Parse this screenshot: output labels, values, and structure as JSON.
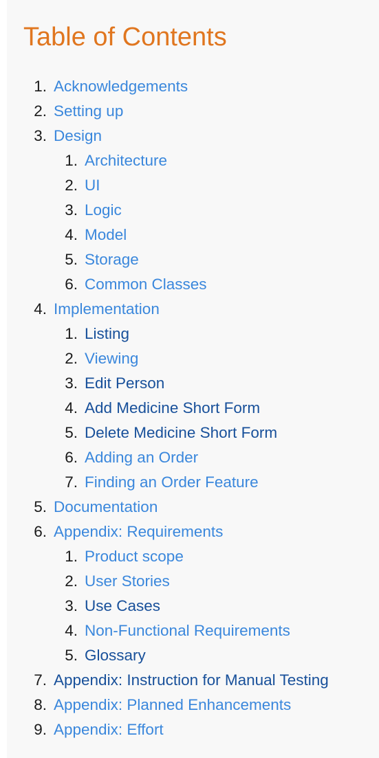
{
  "title": "Table of Contents",
  "items": [
    {
      "number": "1.",
      "label": "Acknowledgements"
    },
    {
      "number": "2.",
      "label": "Setting up"
    },
    {
      "number": "3.",
      "label": "Design",
      "children": [
        {
          "number": "1.",
          "label": "Architecture"
        },
        {
          "number": "2.",
          "label": "UI"
        },
        {
          "number": "3.",
          "label": "Logic"
        },
        {
          "number": "4.",
          "label": "Model"
        },
        {
          "number": "5.",
          "label": "Storage"
        },
        {
          "number": "6.",
          "label": "Common Classes"
        }
      ]
    },
    {
      "number": "4.",
      "label": "Implementation",
      "children": [
        {
          "number": "1.",
          "label": "Listing"
        },
        {
          "number": "2.",
          "label": "Viewing"
        },
        {
          "number": "3.",
          "label": "Edit Person"
        },
        {
          "number": "4.",
          "label": "Add Medicine Short Form"
        },
        {
          "number": "5.",
          "label": "Delete Medicine Short Form"
        },
        {
          "number": "6.",
          "label": "Adding an Order"
        },
        {
          "number": "7.",
          "label": "Finding an Order Feature"
        }
      ]
    },
    {
      "number": "5.",
      "label": "Documentation"
    },
    {
      "number": "6.",
      "label": "Appendix: Requirements",
      "children": [
        {
          "number": "1.",
          "label": "Product scope"
        },
        {
          "number": "2.",
          "label": "User Stories"
        },
        {
          "number": "3.",
          "label": "Use Cases"
        },
        {
          "number": "4.",
          "label": "Non-Functional Requirements"
        },
        {
          "number": "5.",
          "label": "Glossary"
        }
      ]
    },
    {
      "number": "7.",
      "label": "Appendix: Instruction for Manual Testing"
    },
    {
      "number": "8.",
      "label": "Appendix: Planned Enhancements"
    },
    {
      "number": "9.",
      "label": "Appendix: Effort"
    }
  ],
  "colors": {
    "title": "#e0761f",
    "link": "#3a87dc",
    "visited_link": "#18509a",
    "number": "#1a1a1a",
    "background": "#f8f8f8"
  }
}
